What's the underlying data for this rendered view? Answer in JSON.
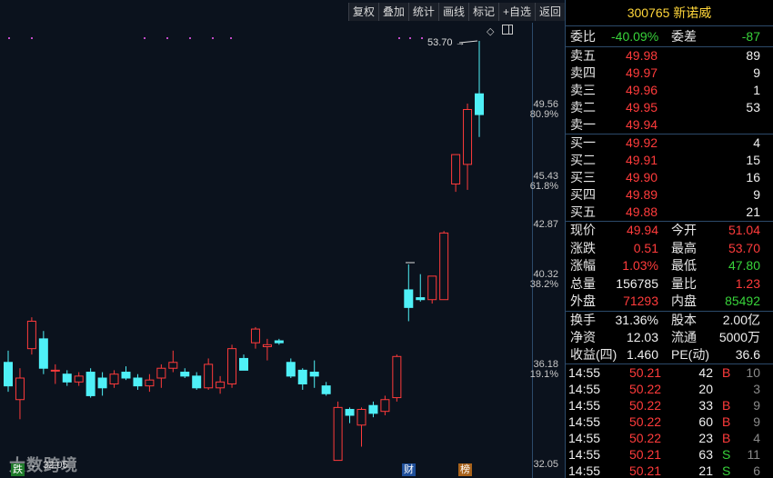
{
  "toolbar": {
    "buttons": [
      "复权",
      "叠加",
      "统计",
      "画线",
      "标记",
      "+自选",
      "返回"
    ]
  },
  "axis": {
    "labels": [
      {
        "price": "49.56",
        "pct": "80.9%"
      },
      {
        "price": "45.43",
        "pct": "61.8%"
      },
      {
        "price": "42.87",
        "pct": ""
      },
      {
        "price": "40.32",
        "pct": "38.2%"
      },
      {
        "price": "36.18",
        "pct": "19.1%"
      },
      {
        "price": "32.05",
        "pct": ""
      }
    ]
  },
  "chart_data": {
    "type": "candlestick",
    "ylim": [
      32.05,
      53.7
    ],
    "high_marker": "53.70",
    "low_marker": "32.05",
    "markers": {
      "die": "跌",
      "cai": "财",
      "bang": "榜"
    },
    "candles": [
      {
        "o": 37.3,
        "h": 37.9,
        "l": 35.8,
        "c": 36.1
      },
      {
        "o": 35.4,
        "h": 37.0,
        "l": 34.4,
        "c": 36.5
      },
      {
        "o": 38.0,
        "h": 39.6,
        "l": 37.7,
        "c": 39.4
      },
      {
        "o": 38.5,
        "h": 38.9,
        "l": 36.7,
        "c": 37.0
      },
      {
        "o": 36.9,
        "h": 37.2,
        "l": 36.2,
        "c": 36.9
      },
      {
        "o": 36.7,
        "h": 36.9,
        "l": 36.1,
        "c": 36.3
      },
      {
        "o": 36.3,
        "h": 36.8,
        "l": 36.1,
        "c": 36.6
      },
      {
        "o": 36.8,
        "h": 37.0,
        "l": 35.5,
        "c": 35.6
      },
      {
        "o": 36.5,
        "h": 36.8,
        "l": 35.6,
        "c": 36.0
      },
      {
        "o": 36.2,
        "h": 36.9,
        "l": 36.0,
        "c": 36.7
      },
      {
        "o": 36.8,
        "h": 37.1,
        "l": 36.4,
        "c": 36.5
      },
      {
        "o": 36.5,
        "h": 36.7,
        "l": 35.9,
        "c": 36.1
      },
      {
        "o": 36.1,
        "h": 36.7,
        "l": 35.8,
        "c": 36.4
      },
      {
        "o": 36.5,
        "h": 37.2,
        "l": 36.0,
        "c": 37.0
      },
      {
        "o": 37.0,
        "h": 37.9,
        "l": 36.8,
        "c": 37.3
      },
      {
        "o": 36.8,
        "h": 37.0,
        "l": 36.5,
        "c": 36.6
      },
      {
        "o": 36.6,
        "h": 36.8,
        "l": 35.9,
        "c": 36.0
      },
      {
        "o": 36.0,
        "h": 37.5,
        "l": 35.9,
        "c": 37.2
      },
      {
        "o": 36.0,
        "h": 36.6,
        "l": 35.7,
        "c": 36.3
      },
      {
        "o": 36.2,
        "h": 38.2,
        "l": 36.0,
        "c": 38.0
      },
      {
        "o": 37.5,
        "h": 37.7,
        "l": 36.9,
        "c": 36.9
      },
      {
        "o": 38.3,
        "h": 39.1,
        "l": 38.0,
        "c": 39.0
      },
      {
        "o": 38.1,
        "h": 38.5,
        "l": 37.4,
        "c": 38.2
      },
      {
        "o": 38.4,
        "h": 38.5,
        "l": 38.2,
        "c": 38.3
      },
      {
        "o": 37.3,
        "h": 37.5,
        "l": 36.5,
        "c": 36.6
      },
      {
        "o": 36.9,
        "h": 37.0,
        "l": 35.9,
        "c": 36.2
      },
      {
        "o": 36.8,
        "h": 37.4,
        "l": 36.0,
        "c": 36.6
      },
      {
        "o": 36.1,
        "h": 36.3,
        "l": 35.6,
        "c": 35.7
      },
      {
        "o": 32.3,
        "h": 35.3,
        "l": 32.3,
        "c": 35.0
      },
      {
        "o": 34.9,
        "h": 35.0,
        "l": 34.2,
        "c": 34.6
      },
      {
        "o": 34.1,
        "h": 35.0,
        "l": 33.0,
        "c": 34.9
      },
      {
        "o": 35.1,
        "h": 35.3,
        "l": 34.5,
        "c": 34.7
      },
      {
        "o": 34.8,
        "h": 35.6,
        "l": 34.6,
        "c": 35.4
      },
      {
        "o": 35.5,
        "h": 37.7,
        "l": 35.3,
        "c": 37.6
      },
      {
        "o": 41.0,
        "h": 42.3,
        "l": 39.4,
        "c": 40.1
      },
      {
        "o": 40.6,
        "h": 41.8,
        "l": 40.4,
        "c": 40.5
      },
      {
        "o": 40.5,
        "h": 41.5,
        "l": 40.3,
        "c": 41.7
      },
      {
        "o": 40.5,
        "h": 44.0,
        "l": 40.5,
        "c": 43.9
      },
      {
        "o": 46.4,
        "h": 47.9,
        "l": 46.0,
        "c": 47.9
      },
      {
        "o": 47.4,
        "h": 50.5,
        "l": 46.1,
        "c": 50.2
      },
      {
        "o": 51.0,
        "h": 53.7,
        "l": 48.8,
        "c": 49.94
      }
    ]
  },
  "quote": {
    "code": "300765",
    "name": "新诺威",
    "weibi_label": "委比",
    "weibi": "-40.09%",
    "weicha_label": "委差",
    "weicha": "-87",
    "asks": [
      {
        "label": "卖五",
        "price": "49.98",
        "vol": "89"
      },
      {
        "label": "卖四",
        "price": "49.97",
        "vol": "9"
      },
      {
        "label": "卖三",
        "price": "49.96",
        "vol": "1"
      },
      {
        "label": "卖二",
        "price": "49.95",
        "vol": "53"
      },
      {
        "label": "卖一",
        "price": "49.94",
        "vol": ""
      }
    ],
    "bids": [
      {
        "label": "买一",
        "price": "49.92",
        "vol": "4"
      },
      {
        "label": "买二",
        "price": "49.91",
        "vol": "15"
      },
      {
        "label": "买三",
        "price": "49.90",
        "vol": "16"
      },
      {
        "label": "买四",
        "price": "49.89",
        "vol": "9"
      },
      {
        "label": "买五",
        "price": "49.88",
        "vol": "21"
      }
    ],
    "stats": [
      {
        "l1": "现价",
        "v1": "49.94",
        "c1": "red",
        "l2": "今开",
        "v2": "51.04",
        "c2": "red"
      },
      {
        "l1": "涨跌",
        "v1": "0.51",
        "c1": "red",
        "l2": "最高",
        "v2": "53.70",
        "c2": "red"
      },
      {
        "l1": "涨幅",
        "v1": "1.03%",
        "c1": "red",
        "l2": "最低",
        "v2": "47.80",
        "c2": "green"
      },
      {
        "l1": "总量",
        "v1": "156785",
        "c1": "white",
        "l2": "量比",
        "v2": "1.23",
        "c2": "red"
      },
      {
        "l1": "外盘",
        "v1": "71293",
        "c1": "red",
        "l2": "内盘",
        "v2": "85492",
        "c2": "green"
      }
    ],
    "finance": [
      {
        "l1": "换手",
        "v1": "31.36%",
        "l2": "股本",
        "v2": "2.00亿"
      },
      {
        "l1": "净资",
        "v1": "12.03",
        "l2": "流通",
        "v2": "5000万"
      },
      {
        "l1": "收益(四)",
        "v1": "1.460",
        "l2": "PE(动)",
        "v2": "36.6"
      }
    ],
    "ticks": [
      {
        "time": "14:55",
        "price": "50.21",
        "vol": "42",
        "side": "B",
        "n": "10"
      },
      {
        "time": "14:55",
        "price": "50.22",
        "vol": "20",
        "side": "",
        "n": "3"
      },
      {
        "time": "14:55",
        "price": "50.22",
        "vol": "33",
        "side": "B",
        "n": "9"
      },
      {
        "time": "14:55",
        "price": "50.22",
        "vol": "60",
        "side": "B",
        "n": "9"
      },
      {
        "time": "14:55",
        "price": "50.22",
        "vol": "23",
        "side": "B",
        "n": "4"
      },
      {
        "time": "14:55",
        "price": "50.21",
        "vol": "63",
        "side": "S",
        "n": "11"
      },
      {
        "time": "14:55",
        "price": "50.21",
        "vol": "21",
        "side": "S",
        "n": "6"
      }
    ]
  },
  "colors": {
    "up": "#ff3b3b",
    "down": "#4ff0f7",
    "label": "#ffd63a",
    "buy": "#ff3b3b",
    "sell": "#38d33a"
  },
  "watermark": "大数跨境"
}
